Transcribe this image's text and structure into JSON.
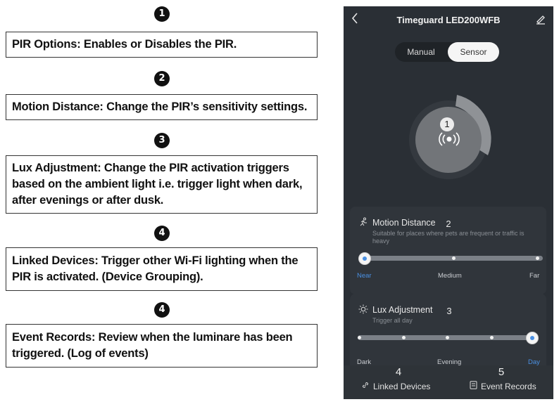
{
  "annotations": [
    {
      "number": "1",
      "text": "PIR Options: Enables or Disables the PIR."
    },
    {
      "number": "2",
      "text": "Motion Distance: Change the PIR’s sensitivity settings."
    },
    {
      "number": "3",
      "text": "Lux Adjustment: Change the PIR activation triggers based on the ambient light i.e. trigger light when dark, after evenings or after dusk."
    },
    {
      "number": "4",
      "text": "Linked Devices: Trigger other Wi-Fi lighting when the PIR is activated. (Device Grouping)."
    },
    {
      "number": "4",
      "text": "Event Records: Review when the luminare has been triggered. (Log of events)"
    }
  ],
  "app": {
    "title": "Timeguard LED200WFB",
    "back_icon": "chevron-left-icon",
    "edit_icon": "pencil-icon",
    "mode_tabs": [
      "Manual",
      "Sensor"
    ],
    "selected_mode": "Sensor",
    "dial_badge": "1",
    "sensor_icon": "motion-sensor-icon",
    "motion_distance": {
      "badge": "2",
      "title": "Motion Distance",
      "description": "Suitable for places where pets are frequent or traffic is heavy",
      "labels": [
        "Near",
        "Medium",
        "Far"
      ],
      "selected": "Near",
      "value_fraction": 0
    },
    "lux_adjustment": {
      "badge": "3",
      "title": "Lux Adjustment",
      "description": "Trigger all day",
      "labels": [
        "Dark",
        "Evening",
        "Day"
      ],
      "selected": "Day",
      "value_fraction": 1
    },
    "bottom_bar": [
      {
        "badge": "4",
        "label": "Linked Devices",
        "icon": "link-icon"
      },
      {
        "badge": "5",
        "label": "Event Records",
        "icon": "document-icon"
      }
    ]
  },
  "colors": {
    "accent": "#4a90e2",
    "app_background": "#2a2f35",
    "card": "#30353b"
  }
}
